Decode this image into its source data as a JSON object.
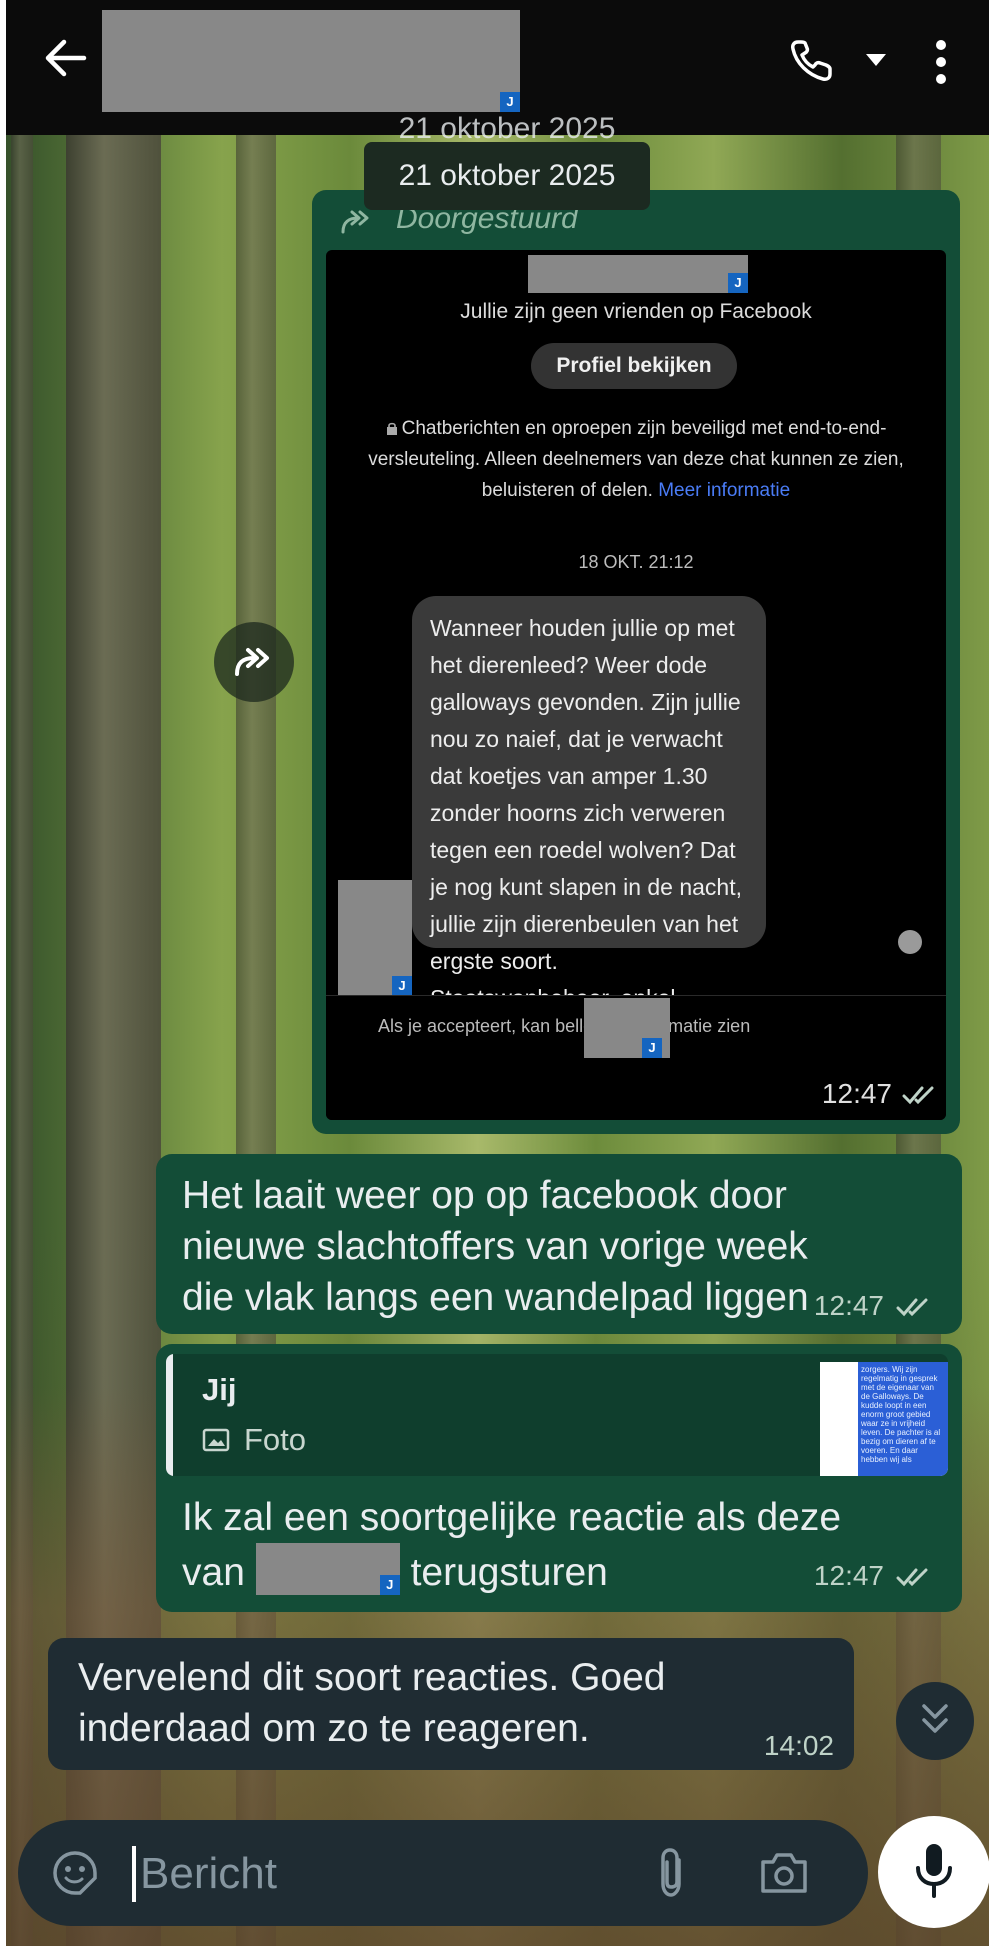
{
  "header": {
    "redaction_mark": "J"
  },
  "date_chip": {
    "label": "21 oktober 2025",
    "ghost_label": "21 oktober 2025"
  },
  "forwarded_message": {
    "forwarded_label": "Doorgestuurd",
    "time": "12:47",
    "screenshot": {
      "redaction_mark": "J",
      "not_friends_text": "Jullie zijn geen vrienden op Facebook",
      "profile_button": "Profiel bekijken",
      "e2e_notice": "Chatberichten en oproepen zijn beveiligd met end-to-end-versleuteling. Alleen deelnemers van deze chat kunnen ze zien, beluisteren of delen.",
      "e2e_link": "Meer informatie",
      "timestamp": "18 OKT. 21:12",
      "message": "Wanneer houden jullie op met het dierenleed? Weer dode galloways gevonden. Zijn jullie nou zo naief, dat je verwacht dat koetjes van amper 1.30 zonder hoorns zich verweren tegen een roedel wolven? Dat je nog kunt slapen in de nacht, jullie zijn dierenbeulen van het ergste soort. Staatswanbeheer, enkel ellende van jullie.",
      "bottom_text": "Als je accepteert, kan            bellen en informatie zien"
    }
  },
  "outgoing_1": {
    "text": "Het laait weer op op facebook door nieuwe slachtoffers van vorige week die vlak langs een wandelpad liggen",
    "time": "12:47"
  },
  "outgoing_2": {
    "reply_author": "Jij",
    "reply_type": "Foto",
    "thumbnail_text": "zorgers. Wij zijn regelmatig in gesprek met de eigenaar van de Galloways. De kudde loopt in een enorm groot gebied waar ze in vrijheid leven. De pachter is al bezig om dieren af te voeren. En daar hebben wij als",
    "text_before": "Ik zal een soortgelijke reactie als deze van",
    "text_after": "terugsturen",
    "time": "12:47"
  },
  "incoming_1": {
    "text": "Vervelend dit soort reacties. Goed inderdaad om zo te reageren.",
    "time": "14:02"
  },
  "input": {
    "placeholder": "Bericht"
  },
  "colors": {
    "header_bg": "#0b0b0b",
    "outgoing_bubble": "#134d37",
    "incoming_bubble": "#1f2c33",
    "link": "#4a7cf6",
    "redaction_badge": "#1565c0"
  },
  "icons": [
    "back-arrow-icon",
    "call-icon",
    "chevron-down-icon",
    "more-vert-icon",
    "forward-icon",
    "double-check-icon",
    "photo-icon",
    "scroll-down-icon",
    "sticker-icon",
    "attach-icon",
    "camera-icon",
    "mic-icon"
  ]
}
